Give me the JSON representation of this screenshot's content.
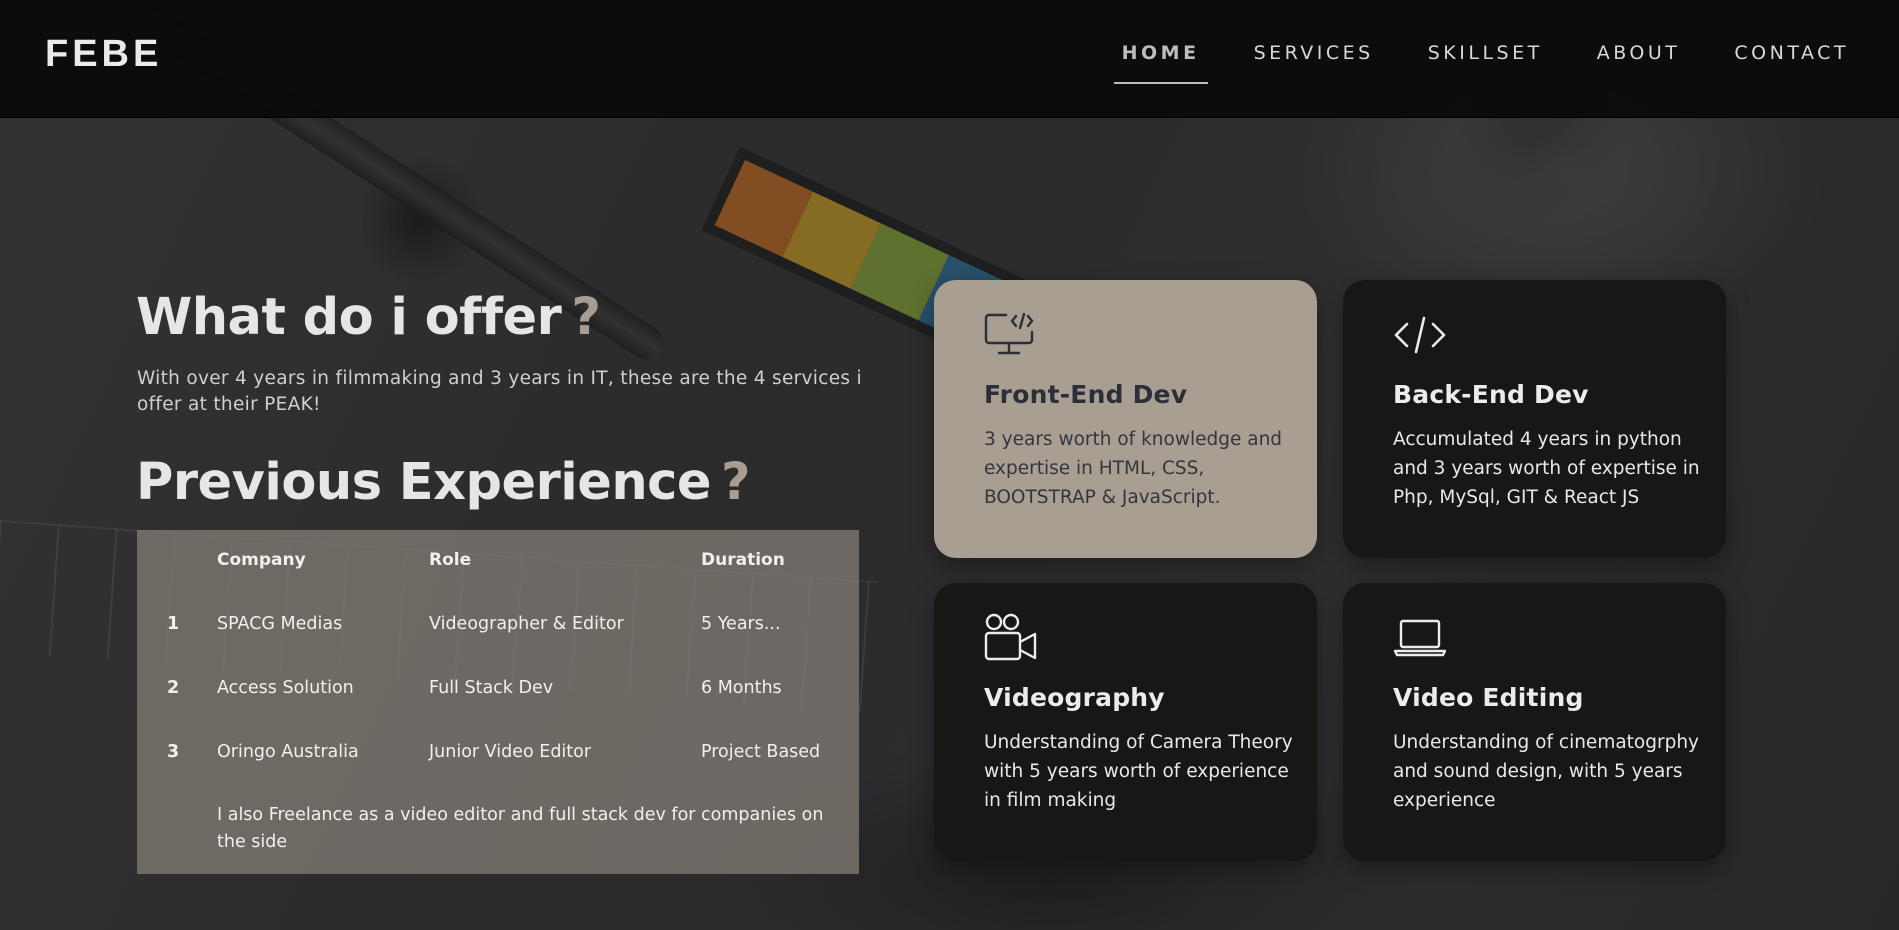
{
  "brand": "FEBE",
  "nav": {
    "items": [
      {
        "label": "HOME",
        "active": true
      },
      {
        "label": "SERVICES",
        "active": false
      },
      {
        "label": "SKILLSET",
        "active": false
      },
      {
        "label": "ABOUT",
        "active": false
      },
      {
        "label": "CONTACT",
        "active": false
      }
    ]
  },
  "offer": {
    "heading": "What do i offer",
    "mark": "?",
    "intro": "With over 4 years in filmmaking and 3 years in IT, these are the 4 services i offer at their PEAK!"
  },
  "experience": {
    "heading": "Previous Experience",
    "mark": "?",
    "columns": [
      "Company",
      "Role",
      "Duration"
    ],
    "rows": [
      {
        "num": "1",
        "company": "SPACG Medias",
        "role": "Videographer & Editor",
        "duration": "5 Years..."
      },
      {
        "num": "2",
        "company": "Access Solution",
        "role": "Full Stack Dev",
        "duration": "6 Months"
      },
      {
        "num": "3",
        "company": "Oringo Australia",
        "role": "Junior Video Editor",
        "duration": "Project Based"
      }
    ],
    "note": "I also Freelance as a video editor and full stack dev for companies on the side"
  },
  "services": [
    {
      "icon": "monitor-code-icon",
      "title": "Front-End Dev",
      "desc": "3 years worth of knowledge and expertise in HTML, CSS, BOOTSTRAP & JavaScript."
    },
    {
      "icon": "code-tag-icon",
      "title": "Back-End Dev",
      "desc": "Accumulated 4 years in python and 3 years worth of expertise in Php, MySql, GIT & React JS"
    },
    {
      "icon": "video-camera-icon",
      "title": "Videography",
      "desc": "Understanding of Camera Theory with 5 years worth of experience in film making"
    },
    {
      "icon": "laptop-icon",
      "title": "Video Editing",
      "desc": "Understanding of cinematogrphy and sound design, with 5 years experience"
    }
  ],
  "colors": {
    "accent_mark": "#a89d90",
    "card_light": "#a89e92",
    "card_dark": "#181716",
    "panel": "#807a72",
    "navbar": "#0a0a0a"
  }
}
